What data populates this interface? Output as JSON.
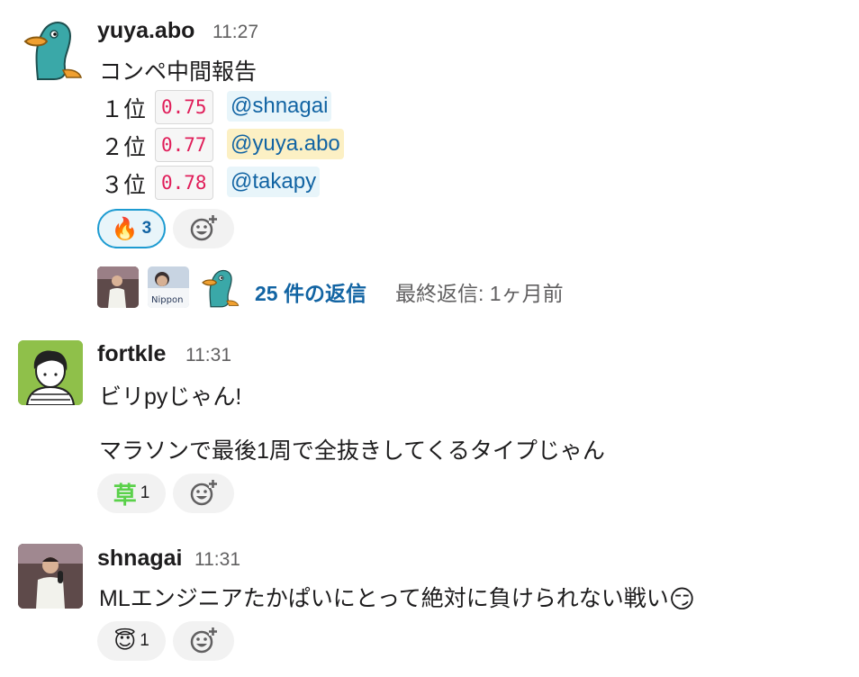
{
  "messages": [
    {
      "user": "yuya.abo",
      "time": "11:27",
      "title": "コンペ中間報告",
      "rankings": [
        {
          "rank": "１位",
          "score": "0.75",
          "mention": "@shnagai"
        },
        {
          "rank": "２位",
          "score": "0.77",
          "mention": "@yuya.abo"
        },
        {
          "rank": "３位",
          "score": "0.78",
          "mention": "@takapy"
        }
      ],
      "reactions": [
        {
          "emoji": "🔥",
          "count": "3"
        }
      ],
      "thread": {
        "replies": "25 件の返信",
        "last_reply": "最終返信: 1ヶ月前"
      }
    },
    {
      "user": "fortkle",
      "time": "11:31",
      "lines": [
        "ビリpyじゃん!",
        "マラソンで最後1周で全抜きしてくるタイプじゃん"
      ],
      "reactions": [
        {
          "emoji": "草",
          "count": "1"
        }
      ]
    },
    {
      "user": "shnagai",
      "time": "11:31",
      "text": "MLエンジニアたかぱいにとって絶対に負けられない戦い",
      "text_emoji": "😏",
      "reactions": [
        {
          "emoji": "😇",
          "count": "1"
        }
      ]
    }
  ],
  "colors": {
    "mention": "#1264a3",
    "code": "#e01e5a",
    "self_mention_bg": "#fcf0c4",
    "active_reaction_border": "#1d9bd1"
  }
}
